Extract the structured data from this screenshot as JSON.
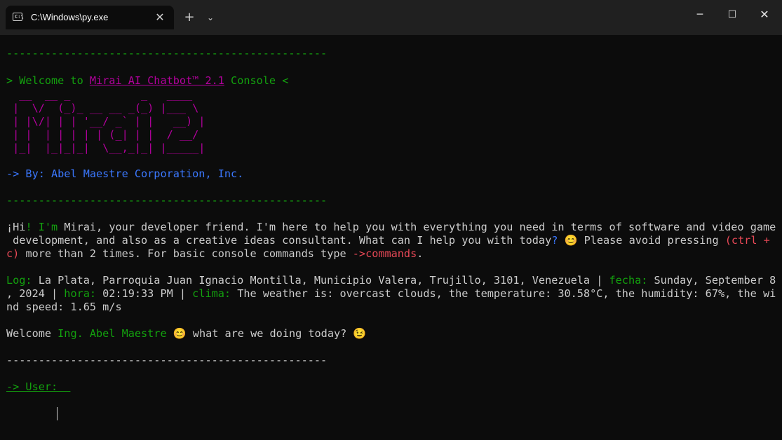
{
  "window": {
    "tab_title": "C:\\Windows\\py.exe",
    "tab_icon": "terminal-icon",
    "tab_icon_text": "C:\\",
    "close_tab_glyph": "✕",
    "new_tab_glyph": "+",
    "dropdown_glyph": "⌄",
    "minimize_glyph": "─",
    "maximize_glyph": "☐",
    "close_glyph": "✕"
  },
  "console": {
    "separator": "--------------------------------------------------",
    "welcome": {
      "prefix": "> Welcome to ",
      "product": "Mirai AI Chatbot™ 2.1",
      "suffix": " Console <"
    },
    "ascii_art": [
      "  __  __ _           _   ____  ",
      " |  \\/  (_)_ __ __ _(_) |___ \\ ",
      " | |\\/| | | '__/ _` | |   __) |",
      " | |  | | | | | (_| | |  / __/ ",
      " |_|  |_|_|_|  \\__,_|_| |_____|"
    ],
    "byline": "-> By: Abel Maestre Corporation, Inc.",
    "intro": {
      "l1_a": "¡",
      "l1_b": "Hi",
      "l1_c": "! I'm ",
      "l1_d": "Mirai",
      "l1_e": ", your developer friend",
      "l1_f": ". I'm here to help you with everything you need in terms of software and video game",
      "l2_a": " development",
      "l2_b": ", and also as a creative ideas consultant",
      "l2_c": ". What can I help you with today",
      "l2_d": "?",
      "l2_e": " 😊 Please avoid pressing ",
      "l2_f": "(ctrl +",
      "l3_a": "c)",
      "l3_b": " more than 2 times",
      "l3_c": ". For basic console commands type ",
      "l3_d": "->commands",
      "l3_e": "."
    },
    "log": {
      "log_label": "Log:",
      "location": " La Plata, Parroquia Juan Ignacio Montilla, Municipio Valera, Trujillo, 3101, Venezuela | ",
      "fecha_label": "fecha:",
      "fecha_a": " Sunday, September 8",
      "fecha_b": ", 2024 | ",
      "hora_label": "hora:",
      "hora_value": " 02:19:33 PM | ",
      "clima_label": "clima:",
      "clima_a": " The weather is: overcast clouds, the temperature: 30.58°C, the humidity: 67%, the wi",
      "clima_b": "nd speed: 1.65 m/s"
    },
    "greeting": {
      "prefix": "Welcome ",
      "name": "Ing. Abel Maestre",
      "suffix": " 😊 what are we doing today? 😉"
    },
    "prompt": "-> User:  "
  }
}
